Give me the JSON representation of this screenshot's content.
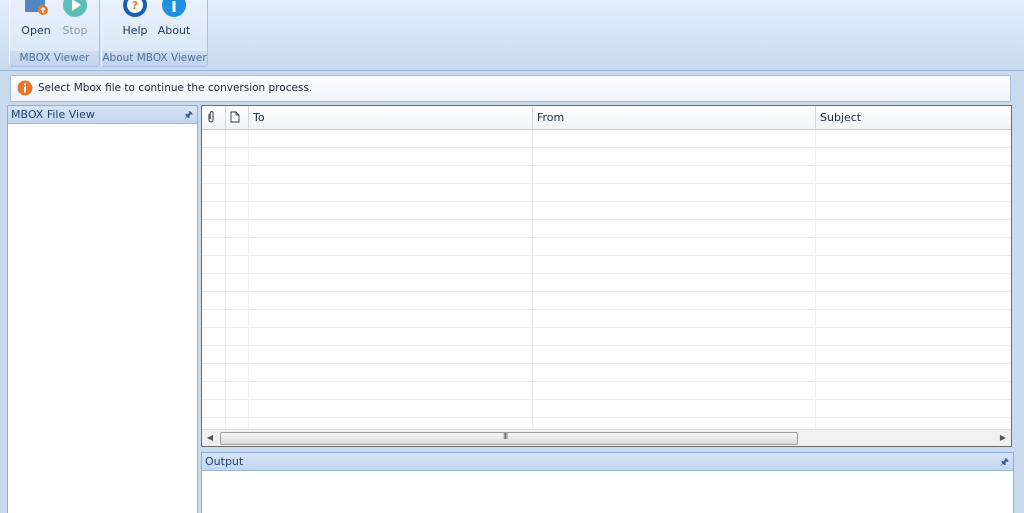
{
  "ribbon": {
    "groups": [
      {
        "label": "MBOX Viewer",
        "buttons": [
          {
            "label": "Open",
            "icon": "open-folder-icon",
            "enabled": true
          },
          {
            "label": "Stop",
            "icon": "stop-play-icon",
            "enabled": false
          }
        ]
      },
      {
        "label": "About MBOX Viewer",
        "buttons": [
          {
            "label": "Help",
            "icon": "help-icon",
            "enabled": true
          },
          {
            "label": "About",
            "icon": "info-icon",
            "enabled": true
          }
        ]
      }
    ]
  },
  "infobar": {
    "message": "Select Mbox file to continue the conversion process.",
    "icon": "info-icon",
    "icon_color": "#e8762b"
  },
  "left_panel": {
    "title": "MBOX File View",
    "pin_icon": "pin-icon"
  },
  "grid": {
    "columns": [
      {
        "label": "",
        "icon": "attachment-icon"
      },
      {
        "label": "",
        "icon": "document-icon"
      },
      {
        "label": "To"
      },
      {
        "label": "From"
      },
      {
        "label": "Subject"
      }
    ],
    "rows": [],
    "scroll_grip": "III"
  },
  "output_panel": {
    "title": "Output"
  },
  "colors": {
    "ribbon_bg": "#d3e2f4",
    "panel_header": "#c2d6ef",
    "accent_blue": "#1a6fc0",
    "stop_teal": "#5bbfb7"
  }
}
